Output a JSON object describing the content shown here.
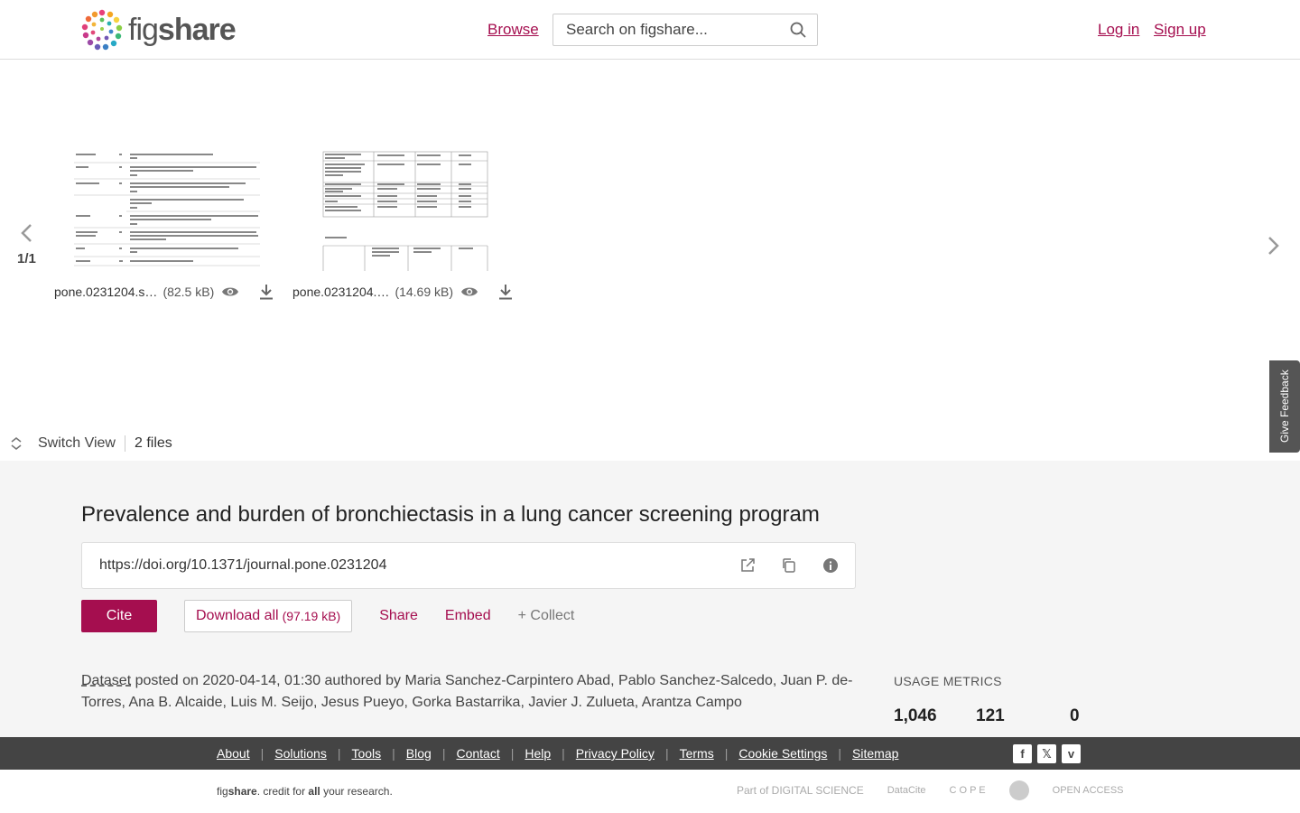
{
  "header": {
    "brand": "figshare",
    "browse_label": "Browse",
    "search_placeholder": "Search on figshare...",
    "login_label": "Log in",
    "signup_label": "Sign up"
  },
  "viewer": {
    "page_indicator": "1/1",
    "files": [
      {
        "name": "pone.0231204.s…",
        "size": "(82.5 kB)"
      },
      {
        "name": "pone.0231204.…",
        "size": "(14.69 kB)"
      }
    ],
    "switch_view_label": "Switch View",
    "files_count": "2 files",
    "feedback_label": "Give Feedback"
  },
  "item": {
    "title": "Prevalence and burden of bronchiectasis in a lung cancer screening program",
    "doi": "https://doi.org/10.1371/journal.pone.0231204",
    "cite_label": "Cite",
    "download_label": "Download all",
    "download_size": "(97.19 kB)",
    "share_label": "Share",
    "embed_label": "Embed",
    "collect_label": "+ Collect",
    "item_type": "Dataset",
    "posted_text": " posted on 2020-04-14, 01:30 authored by Maria Sanchez-Carpintero Abad, Pablo Sanchez-Salcedo, Juan P. de-Torres, Ana B. Alcaide, Luis M. Seijo, Jesus Pueyo, Gorka Bastarrika, Javier J. Zulueta, Arantza Campo"
  },
  "usage": {
    "label": "USAGE METRICS",
    "views": "1,046",
    "downloads": "121",
    "citations": "0"
  },
  "footer": {
    "links": [
      "About",
      "Solutions",
      "Tools",
      "Blog",
      "Contact",
      "Help",
      "Privacy Policy",
      "Terms",
      "Cookie Settings",
      "Sitemap"
    ],
    "credit_brand_a": "fig",
    "credit_brand_b": "share",
    "credit_a": ". credit for ",
    "credit_b": "all",
    "credit_c": " your research.",
    "partners": [
      "Part of DIGITAL SCIENCE",
      "DataCite",
      "C O P E",
      "OPEN ACCESS"
    ]
  },
  "colors": {
    "accent": "#a50e4f",
    "footer_bg": "#444444",
    "details_bg": "#f5f5f5"
  }
}
